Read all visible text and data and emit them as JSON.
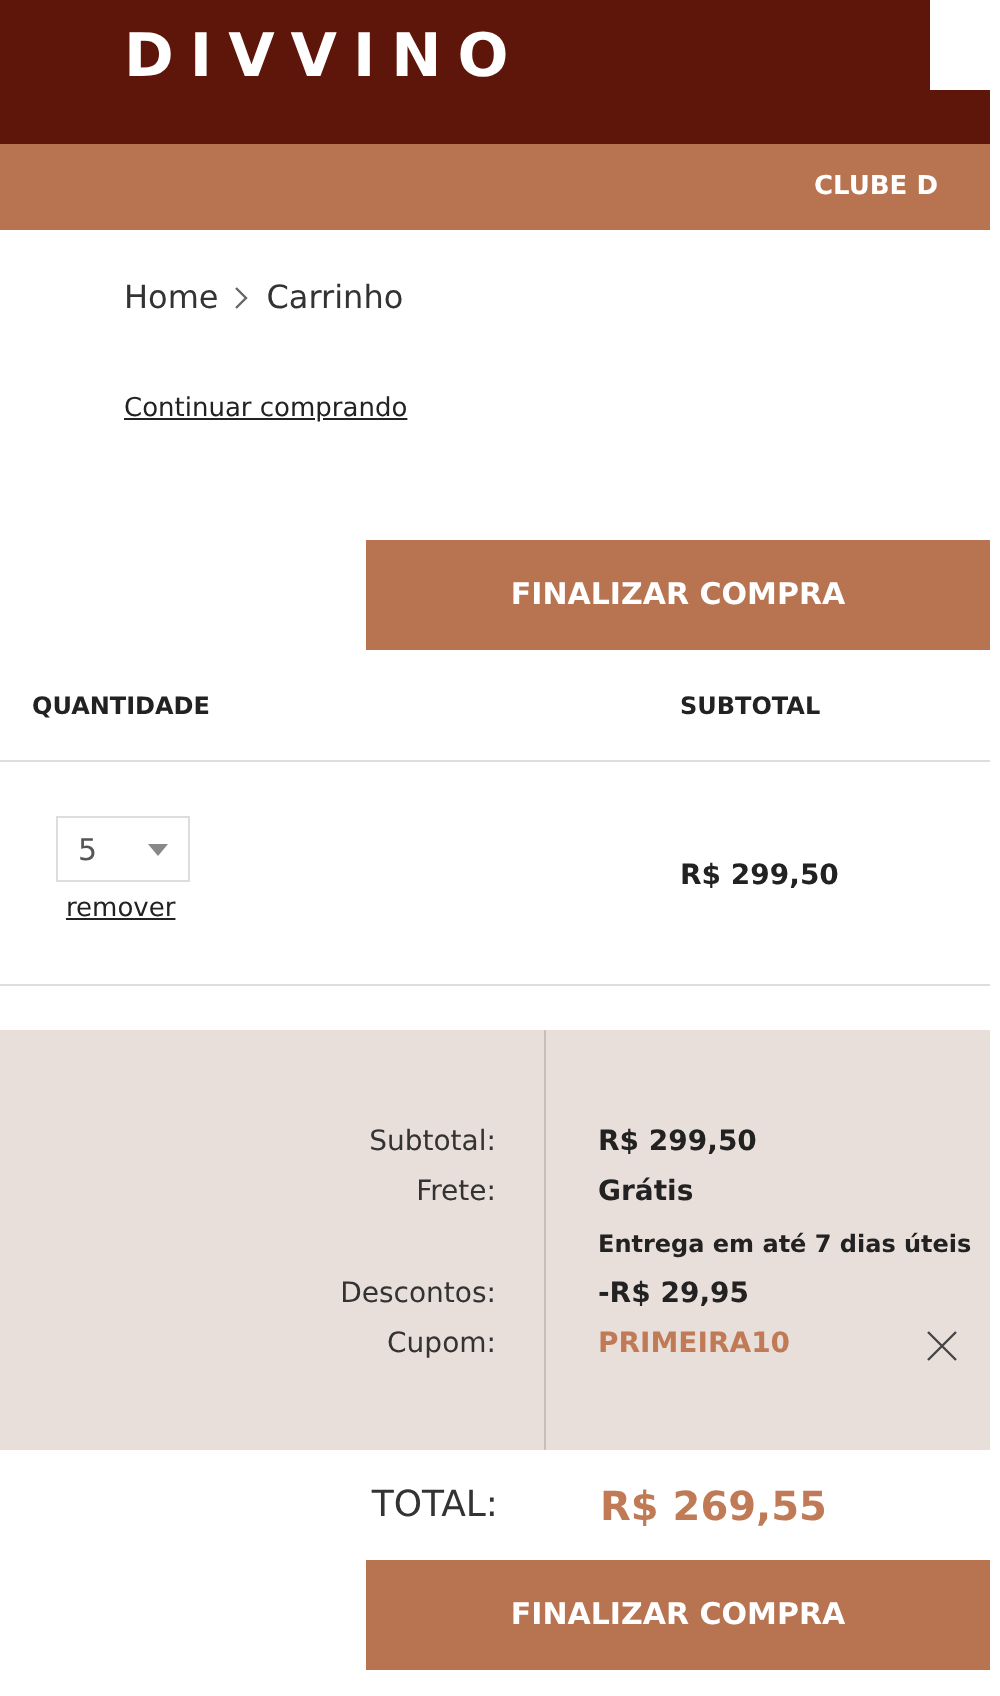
{
  "header": {
    "logo": "DIVVINO",
    "nav_item": "CLUBE D"
  },
  "breadcrumb": [
    {
      "label": "Home"
    },
    {
      "label": "Carrinho"
    }
  ],
  "continue_link": "Continuar comprando",
  "checkout_button_top": "FINALIZAR COMPRA",
  "table": {
    "columns": [
      "QUANTIDADE",
      "SUBTOTAL"
    ],
    "rows": [
      {
        "quantity": "5",
        "remove": "remover",
        "subtotal": "R$ 299,50"
      }
    ]
  },
  "summary": {
    "rows": [
      {
        "label": "Subtotal:",
        "value": "R$ 299,50",
        "kind": "amount"
      },
      {
        "label": "Frete:",
        "value": "Grátis",
        "note": "Entrega em até 7 dias úteis",
        "kind": "amount"
      },
      {
        "label": "Descontos:",
        "value": "-R$ 29,95",
        "kind": "amount"
      },
      {
        "label": "Cupom:",
        "value": "PRIMEIRA10",
        "kind": "coupon"
      }
    ]
  },
  "total": {
    "label": "TOTAL:",
    "value": "R$ 269,55"
  },
  "checkout_button_bottom": "FINALIZAR COMPRA"
}
